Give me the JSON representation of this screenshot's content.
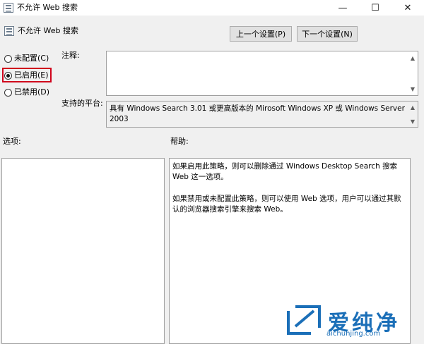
{
  "window": {
    "title": "不允许 Web 搜索",
    "controls": {
      "minimize": "—",
      "maximize": "☐",
      "close": "✕"
    }
  },
  "header": {
    "policy_name": "不允许 Web 搜索",
    "prev_button": "上一个设置(P)",
    "next_button": "下一个设置(N)"
  },
  "state_options": [
    {
      "label": "未配置(C)",
      "checked": false
    },
    {
      "label": "已启用(E)",
      "checked": true
    },
    {
      "label": "已禁用(D)",
      "checked": false
    }
  ],
  "comment": {
    "label": "注释:",
    "value": ""
  },
  "supported": {
    "label": "支持的平台:",
    "value": "具有 Windows Search 3.01 或更高版本的 Mirosoft Windows XP 或 Windows Server 2003"
  },
  "options": {
    "label": "选项:"
  },
  "help": {
    "label": "帮助:",
    "paragraphs": [
      "如果启用此策略，则可以删除通过 Windows Desktop Search 搜索 Web 这一选项。",
      "如果禁用或未配置此策略，则可以使用 Web 选项，用户可以通过其默认的浏览器搜索引擎来搜索 Web。"
    ]
  },
  "watermark": {
    "name": "爱纯净",
    "url": "aichunjing.com"
  },
  "colors": {
    "highlight": "#d0021b",
    "watermark": "#1b6fb8"
  }
}
